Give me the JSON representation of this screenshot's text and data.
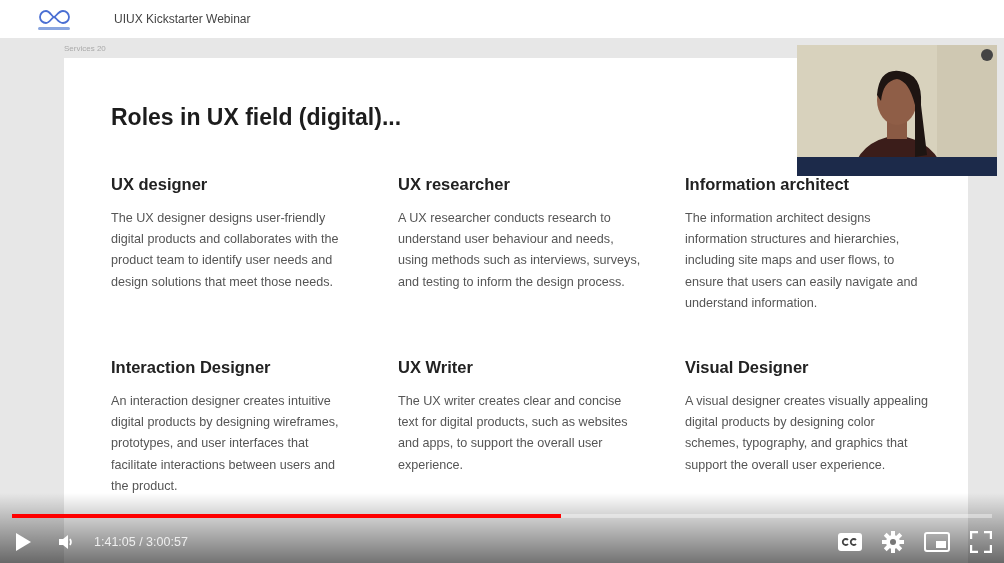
{
  "header": {
    "title": "UIUX Kickstarter Webinar"
  },
  "slide": {
    "label": "Services 20",
    "title": "Roles in UX field (digital)...",
    "roles": [
      {
        "heading": "UX designer",
        "text": "The UX designer designs user-friendly digital products and collaborates with the product team to identify user needs and design solutions that meet those needs."
      },
      {
        "heading": "UX researcher",
        "text": "A UX researcher conducts research to understand user behaviour and needs, using methods such as interviews, surveys, and testing to inform the design process."
      },
      {
        "heading": "Information architect",
        "text": "The information architect designs information structures and hierarchies, including site maps and user flows, to ensure that users can easily navigate and understand information."
      },
      {
        "heading": "Interaction Designer",
        "text": "An interaction designer creates intuitive digital products by designing wireframes, prototypes, and user interfaces that facilitate interactions between users and the product."
      },
      {
        "heading": "UX Writer",
        "text": "The UX writer creates clear and concise text for digital products, such as websites and apps, to support the overall user experience."
      },
      {
        "heading": "Visual Designer",
        "text": "A visual designer creates visually appealing digital products by designing color schemes, typography, and graphics that support the overall user experience."
      }
    ]
  },
  "player": {
    "progress": {
      "level": 0.56
    },
    "time": "1:41:05 / 3:00:57"
  }
}
